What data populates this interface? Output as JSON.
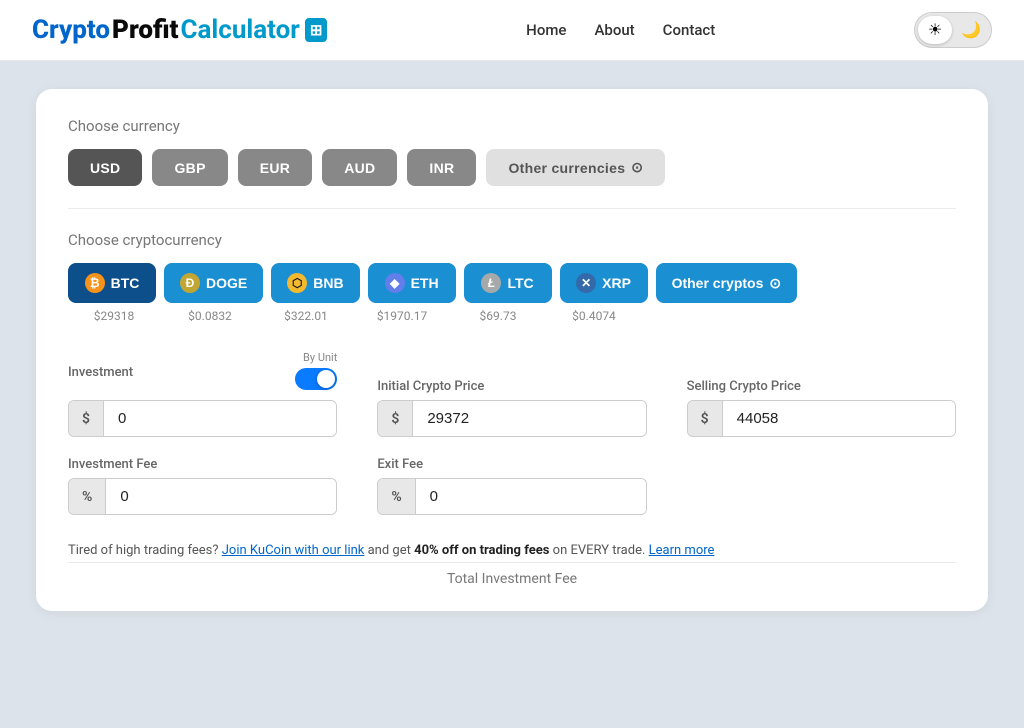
{
  "header": {
    "logo": {
      "crypto": "Crypto",
      "profit": "Profit",
      "calculator": "Calculator",
      "icon": "▦"
    },
    "nav": {
      "home": "Home",
      "about": "About",
      "contact": "Contact"
    },
    "theme": {
      "light_icon": "☀",
      "dark_icon": "🌙"
    }
  },
  "currency_section": {
    "label": "Choose currency",
    "buttons": [
      {
        "id": "usd",
        "label": "USD",
        "active": true
      },
      {
        "id": "gbp",
        "label": "GBP",
        "active": false
      },
      {
        "id": "eur",
        "label": "EUR",
        "active": false
      },
      {
        "id": "aud",
        "label": "AUD",
        "active": false
      },
      {
        "id": "inr",
        "label": "INR",
        "active": false
      }
    ],
    "other_label": "Other currencies",
    "other_icon": "⊙"
  },
  "crypto_section": {
    "label": "Choose cryptocurrency",
    "cryptos": [
      {
        "id": "btc",
        "label": "BTC",
        "price": "$29318",
        "icon": "₿",
        "icon_class": "btc-icon",
        "active": true
      },
      {
        "id": "doge",
        "label": "DOGE",
        "price": "$0.0832",
        "icon": "Ð",
        "icon_class": "doge-icon",
        "active": false
      },
      {
        "id": "bnb",
        "label": "BNB",
        "price": "$322.01",
        "icon": "⬡",
        "icon_class": "bnb-icon",
        "active": false
      },
      {
        "id": "eth",
        "label": "ETH",
        "price": "$1970.17",
        "icon": "♦",
        "icon_class": "eth-icon",
        "active": false
      },
      {
        "id": "ltc",
        "label": "LTC",
        "price": "$69.73",
        "icon": "Ł",
        "icon_class": "ltc-icon",
        "active": false
      },
      {
        "id": "xrp",
        "label": "XRP",
        "price": "$0.4074",
        "icon": "✕",
        "icon_class": "xrp-icon",
        "active": false
      }
    ],
    "other_label": "Other cryptos",
    "other_icon": "⊙"
  },
  "calculator": {
    "by_unit_label": "By Unit",
    "investment_label": "Investment",
    "investment_prefix": "$",
    "investment_value": "0",
    "initial_price_label": "Initial Crypto Price",
    "initial_price_prefix": "$",
    "initial_price_value": "29372",
    "selling_price_label": "Selling Crypto Price",
    "selling_price_prefix": "$",
    "selling_price_value": "44058",
    "investment_fee_label": "Investment Fee",
    "investment_fee_prefix": "%",
    "investment_fee_value": "0",
    "exit_fee_label": "Exit Fee",
    "exit_fee_prefix": "%",
    "exit_fee_value": "0"
  },
  "promo": {
    "text_before": "Tired of high trading fees?",
    "link_text": "Join KuCoin with our link",
    "text_middle": "and get",
    "bold_text": "40% off on trading fees",
    "text_after": "on EVERY trade.",
    "learn_more": "Learn more"
  },
  "total_fee": {
    "label": "Total Investment Fee"
  }
}
